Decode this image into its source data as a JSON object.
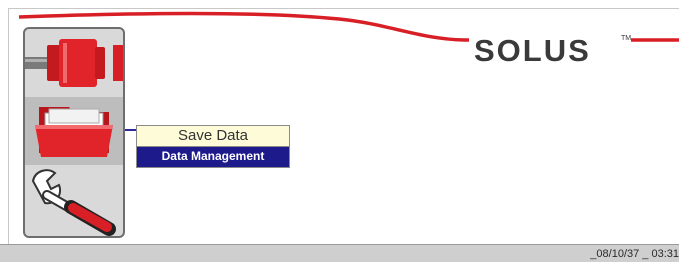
{
  "brand": {
    "logo": "SOLUS",
    "tm": "TM"
  },
  "menu": {
    "items": [
      {
        "icon": "cable-connector-icon",
        "selected": false
      },
      {
        "icon": "folder-icon",
        "selected": true
      },
      {
        "icon": "wrench-icon",
        "selected": false
      }
    ]
  },
  "tooltip": {
    "action": "Save Data",
    "category": "Data Management"
  },
  "status_bar": {
    "datetime": "_08/10/37 _ 03:31"
  },
  "colors": {
    "accent_red": "#d81f26",
    "tooltip_top_bg": "#fdfbd8",
    "tooltip_bottom_bg": "#1d1a8c",
    "panel_bg": "#d9d9d9"
  }
}
